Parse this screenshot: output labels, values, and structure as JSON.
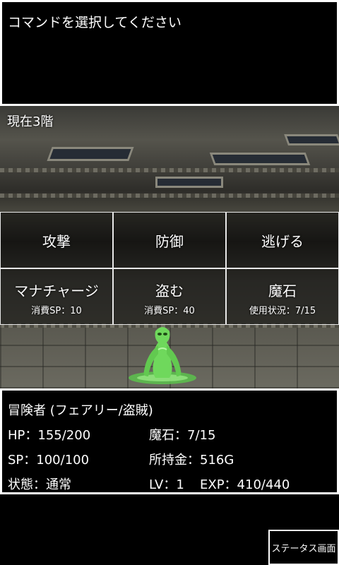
{
  "message": "コマンドを選択してください",
  "floor": "現在3階",
  "commands": [
    {
      "label": "攻撃"
    },
    {
      "label": "防御"
    },
    {
      "label": "逃げる"
    },
    {
      "label": "マナチャージ",
      "sub": "消費SP：10"
    },
    {
      "label": "盗む",
      "sub": "消費SP：40"
    },
    {
      "label": "魔石",
      "sub": "使用状況：7/15"
    }
  ],
  "status": {
    "name": "冒険者 (フェアリー/盗賊)",
    "hp": "HP：155/200",
    "sp": "SP：100/100",
    "condition": "状態：通常",
    "magic_stone": "魔石：7/15",
    "gold": "所持金：516G",
    "level": "LV：1",
    "exp": "EXP：410/440"
  },
  "status_screen_button": "ステータス画面",
  "colors": {
    "monster": "#7be06a",
    "panel_border": "#ffffff",
    "background": "#000000"
  },
  "icons": {
    "monster": "green-slime-humanoid"
  }
}
